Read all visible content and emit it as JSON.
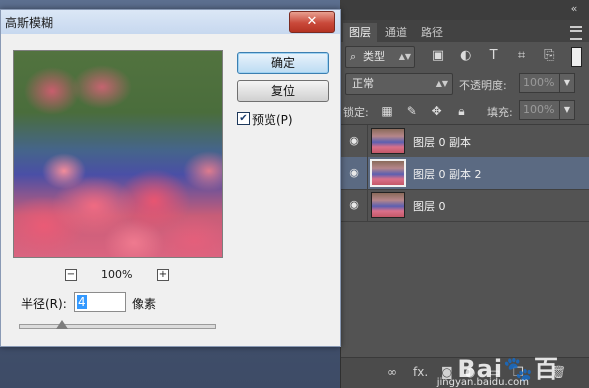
{
  "dialog": {
    "title": "高斯模糊",
    "close_label": "✕",
    "ok_label": "确定",
    "reset_label": "复位",
    "preview_label": "预览(P)",
    "preview_checked": true,
    "zoom_out_label": "−",
    "zoom_in_label": "+",
    "zoom_value": "100%",
    "radius_label": "半径(R):",
    "radius_value": "4",
    "radius_unit": "像素"
  },
  "layers_panel": {
    "tabs": [
      "图层",
      "通道",
      "路径"
    ],
    "collapse_label": "«",
    "kind_label": "类型",
    "blend_mode": "正常",
    "opacity_label": "不透明度:",
    "opacity_value": "100%",
    "lock_label": "锁定:",
    "fill_label": "填充:",
    "fill_value": "100%",
    "layers": [
      {
        "name": "图层 0 副本",
        "selected": false
      },
      {
        "name": "图层 0 副本 2",
        "selected": true
      },
      {
        "name": "图层 0",
        "selected": false
      }
    ],
    "bottom_fx": "fx."
  },
  "watermark": {
    "logo": "Bai🐾百",
    "url": "jingyan.baidu.com"
  },
  "colors": {
    "panel_bg": "#535353",
    "selected_layer": "#5b6a82",
    "dialog_bg": "#f0f0f0",
    "close_red": "#c9493a"
  }
}
